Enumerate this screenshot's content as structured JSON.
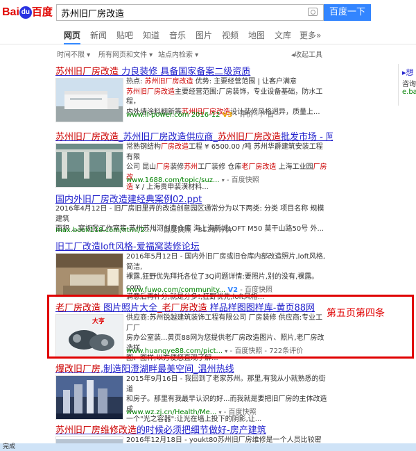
{
  "header": {
    "logo_text": "Bai",
    "logo_paw": "du",
    "logo_cn": "百度",
    "search_value": "苏州旧厂房改造",
    "search_button": "百度一下"
  },
  "tabs": [
    "网页",
    "新闻",
    "贴吧",
    "知道",
    "音乐",
    "图片",
    "视频",
    "地图",
    "文库",
    "更多»"
  ],
  "filters": {
    "time": "时间不限",
    "scope": "所有网页和文件",
    "site": "站点内检索",
    "collapse": "收起工具"
  },
  "results": [
    {
      "title_parts": [
        "苏州旧厂房改造",
        " 力良装修 具备国家备案二级资质"
      ],
      "text": [
        [
          "热点: ",
          "苏州旧厂房改造",
          "    优势: 主要经营范围 | 让客户满意"
        ],
        [
          "",
          "苏州旧厂房改造",
          "主要经营范围:厂房装饰，专业设备基础，防水工程，"
        ],
        [
          "内外墙涂料翻新等",
          "苏州旧厂房改造",
          "设计装修风格迥异，质量上..."
        ]
      ],
      "meta_url": "www.ll-power.com",
      "meta_date": "2016-12",
      "meta_v": "V3",
      "meta_extra": "- 评价 - 广告"
    },
    {
      "title_parts": [
        "苏州旧厂房改造",
        "_苏州旧厂房改造供应商_",
        "苏州旧厂房改造",
        "批发市场 - 阿里巴巴"
      ],
      "text": [
        [
          "常熟钢结构",
          "厂房改造",
          "工程 ¥ 6500.00 /吨 苏州华爵建筑安装工程有限"
        ],
        [
          "公司 昆山",
          "厂房",
          "装修",
          "苏州",
          "工厂装修 仓库",
          "老厂房改造",
          " 上海工业园",
          "厂房改"
        ],
        [
          "造",
          " ¥ / 上海贵申装潢材料..."
        ]
      ],
      "meta_url": "www.1688.com/topic/suz...",
      "meta_extra": " - 百度快照"
    },
    {
      "title": "国内外旧厂房改造建经典案例02.ppt",
      "lines": [
        "2016年4月12日 - 旧厂房旧里弄的改造创意园区通常分为以下两类: 分类 项目名称 规模 建筑",
        "面积 ...窒视我工作室等 苏州苏州河创意仓库 海上海新城LOFT M50 莫干山路50号 外..."
      ],
      "meta_url": "max.book118.com/html/2...",
      "meta_extra": " - 百度快照 - 313条评价"
    },
    {
      "title": "旧工厂改造loft风格-爱福窝装修论坛",
      "text": [
        "2016年5月12日 - 国内外旧厂房或旧仓库内部改造照片,loft风格,简洁,",
        "裸露,狂野优先拜托各位了3Q问题详情:要照片,别的没有,裸露。com",
        "满意后再补分,就是分多!,狂野优先,loft风格..."
      ],
      "meta_url": "www.fuwo.com/community...",
      "meta_v": "V2",
      "meta_extra": " - 百度快照"
    },
    {
      "title_parts": [
        "老厂房改造",
        " 图片照片大全",
        "_老厂房改造",
        " 样品样图图样库-黄页88网"
      ],
      "text": [
        "供应商:苏州锐越建筑装饰工程有限公司 厂房装修 供应商:专业工厂厂",
        "房办公室装...黄页88网为您提供老厂房改造图片、照片,老厂房改造样",
        "图、图样,以方便您直观了解..."
      ],
      "meta_url": "www.huangye88.com/pict...",
      "meta_extra": " - 百度快照 - 722条评价",
      "thumb_label": "大亨"
    },
    {
      "title_parts": [
        "爆改旧厂房",
        ",制造阳澄湖畔最美空间_温州热线"
      ],
      "text": [
        "2015年9月16日 - 我回到了老家苏州。那里,有我从小就熟悉的街道",
        "和房子。那里有我最早认识的好...而我就是要把旧厂房的主体改造成",
        "一个\"光之容器\":让光在墙上投下的阴影,让..."
      ],
      "meta_url": "www.wz.zj.cn/Health/Me...",
      "meta_extra": " - 百度快照"
    },
    {
      "title_parts": [
        "苏州旧厂房维修改造",
        "的时候必须把细节做好-房产建筑"
      ],
      "text": [
        "2016年12月18日 - youkt80苏州旧厂房维修是一个人员比较密集的生产"
      ]
    }
  ],
  "annotation": "第五页第四条",
  "side": {
    "link": "▸想",
    "text": "咨询",
    "url": "e.ba"
  },
  "status": "完成"
}
